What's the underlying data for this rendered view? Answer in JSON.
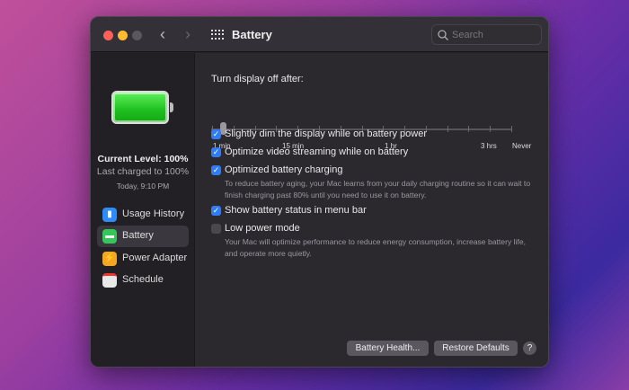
{
  "window": {
    "title": "Battery",
    "search_placeholder": "Search"
  },
  "battery_status": {
    "current_level": "Current Level: 100%",
    "last_charged": "Last charged to 100%",
    "time": "Today, 9:10 PM",
    "level_percent": 100
  },
  "sidebar": {
    "items": [
      {
        "label": "Usage History",
        "icon": "bar-chart-icon",
        "color": "#2f8cf6"
      },
      {
        "label": "Battery",
        "icon": "battery-icon",
        "color": "#34c759",
        "selected": true
      },
      {
        "label": "Power Adapter",
        "icon": "bolt-icon",
        "color": "#f5a623"
      },
      {
        "label": "Schedule",
        "icon": "calendar-icon",
        "color": "#e8e8e8"
      }
    ]
  },
  "display_off": {
    "label": "Turn display off after:",
    "tick_labels": [
      "1 min",
      "15 min",
      "1 hr",
      "3 hrs",
      "Never"
    ],
    "value": "1 min"
  },
  "options": [
    {
      "label": "Slightly dim the display while on battery power",
      "checked": true
    },
    {
      "label": "Optimize video streaming while on battery",
      "checked": true
    },
    {
      "label": "Optimized battery charging",
      "checked": true,
      "description": "To reduce battery aging, your Mac learns from your daily charging routine so it can wait to finish charging past 80% until you need to use it on battery."
    },
    {
      "label": "Show battery status in menu bar",
      "checked": true
    },
    {
      "label": "Low power mode",
      "checked": false,
      "description": "Your Mac will optimize performance to reduce energy consumption, increase battery life, and operate more quietly."
    }
  ],
  "buttons": {
    "battery_health": "Battery Health...",
    "restore_defaults": "Restore Defaults",
    "help": "?"
  }
}
